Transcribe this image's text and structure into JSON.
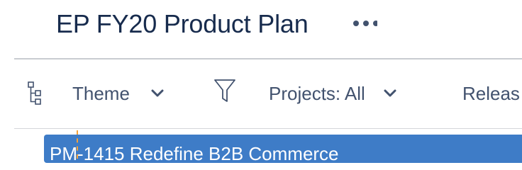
{
  "header": {
    "title": "EP FY20 Product Plan",
    "more_icon": "more-horizontal-icon"
  },
  "toolbar": {
    "hierarchy_icon": "hierarchy-icon",
    "theme_label": "Theme",
    "filter_icon": "filter-icon",
    "projects_label": "Projects: All",
    "release_label": "Releas"
  },
  "timeline": {
    "bar_label": "PM-1415 Redefine B2B Commerce",
    "bar_color": "#3e7cc7",
    "today_marker_color": "#f5a23a"
  }
}
